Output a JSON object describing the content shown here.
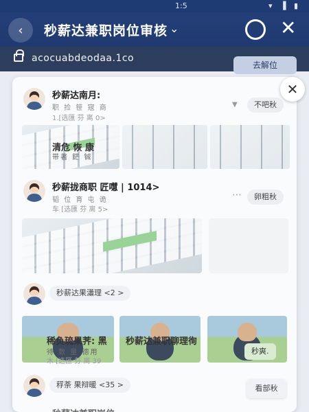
{
  "status": {
    "time": "1:5",
    "icons": "▾ ▐ ▮"
  },
  "header": {
    "back_icon": "back-arrow-icon",
    "title": "秒薪达兼职岗位审核",
    "caret": "⌄",
    "search_icon": "search-icon",
    "close_icon": "close-icon"
  },
  "urlbar": {
    "url": "acocuabdeodaa.1co",
    "lock_icon": "lock-icon"
  },
  "ghost_button": "去解位",
  "sheet_close": "✕",
  "cards": [
    {
      "name": "秒薪达南月:",
      "sub": "职 捡 笹 宼 商",
      "meta": "1.[选匯 芬 离 0>",
      "action": "不吧秋",
      "overlay_title": "清危 恢  康",
      "overlay_sub": "带著  鋩   铖"
    },
    {
      "name": "秒薪拢商职 匠嚖 | 1014>",
      "sub": "韬 位 育 屯 诡",
      "meta": "车 [选匯 芬 离 5>",
      "action": "卵粗秋"
    },
    {
      "tag": "秒薪达果瀟理 <2 >",
      "overlay_title": "稀负琉果荠: 黑",
      "overlay_sub": "待  数  量  德用",
      "overlay_meta": "木 [选匯 芬 离 39",
      "center_text": "秒薪达兼职聊理徇",
      "side_button": "秒爽."
    },
    {
      "tag": "稃荼 果辩暖 <35 >",
      "action": "看部秋",
      "tail": "秒薪达兼职岗位..."
    }
  ]
}
